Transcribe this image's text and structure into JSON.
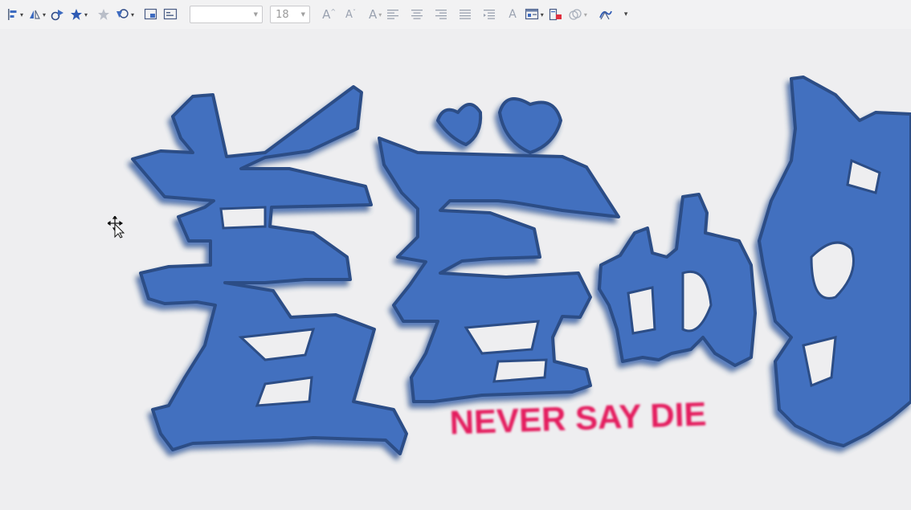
{
  "toolbar": {
    "font_name": {
      "value": ""
    },
    "font_size": {
      "value": "18"
    },
    "buttons": [
      {
        "name": "align-objects",
        "icon": "align-objects-icon",
        "dropdown": true
      },
      {
        "name": "flip",
        "icon": "flip-icon",
        "dropdown": true
      },
      {
        "name": "select-at-3d",
        "icon": "3d-select-icon",
        "dropdown": false
      },
      {
        "name": "stars",
        "icon": "star-icon",
        "dropdown": true
      },
      {
        "name": "star-disabled",
        "icon": "star-outline-icon",
        "dropdown": false
      },
      {
        "name": "shapes",
        "icon": "shapes-icon",
        "dropdown": true
      },
      {
        "name": "insert-frame",
        "icon": "frame-icon",
        "dropdown": false
      },
      {
        "name": "text-box",
        "icon": "textbox-icon",
        "dropdown": false
      }
    ],
    "text_buttons": {
      "grow_font": "A",
      "shrink_font": "A",
      "font_color": "A",
      "character": "A"
    }
  },
  "artwork": {
    "chinese_title": "羞羞的铁",
    "subtitle": "NEVER SAY DIE",
    "colors": {
      "fill": "#4270bf",
      "outline": "#2c4d86",
      "glow": "#e8386f",
      "subtitle": "#e41e5e",
      "background": "#eeeef0"
    }
  }
}
